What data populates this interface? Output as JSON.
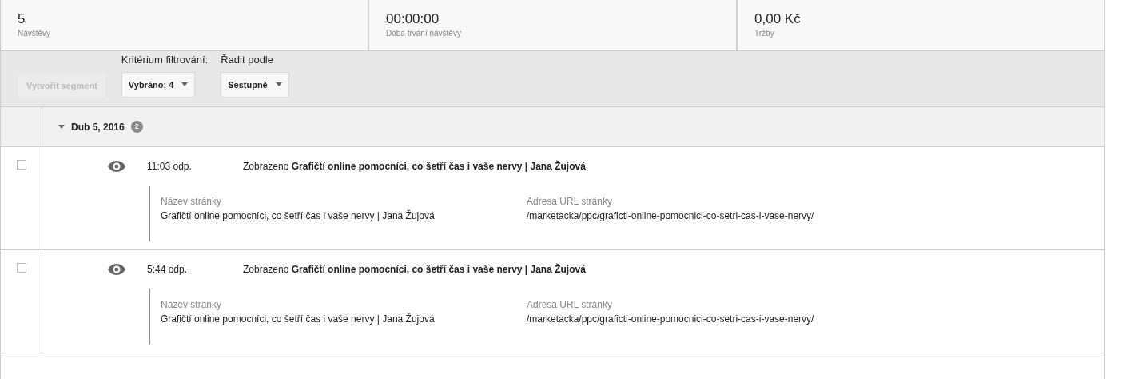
{
  "metrics": [
    {
      "value": "5",
      "label": "Návštěvy"
    },
    {
      "value": "00:00:00",
      "label": "Doba trvání návštěvy"
    },
    {
      "value": "0,00 Kč",
      "label": "Tržby"
    }
  ],
  "toolbar": {
    "create_segment": {
      "label": "Vytvořit segment",
      "disabled": true
    },
    "filters": [
      {
        "label": "Kritérium filtrování:",
        "value": "Vybráno: 4"
      },
      {
        "label": "Řadit podle",
        "value": "Sestupně"
      }
    ]
  },
  "groups": [
    {
      "date": "Dub 5, 2016",
      "count": "2",
      "expanded": true,
      "events": [
        {
          "checked": false,
          "time": "11:03 odp.",
          "description": "Zobrazeno **Grafičtí online pomocníci, co šetří čas i vaše nervy | Jana Žujová**",
          "title_label": "Název stránky",
          "title": "Grafičtí online pomocníci, co šetří čas i vaše nervy | Jana Žujová",
          "url_label": "Adresa URL stránky",
          "url": "/marketacka/ppc/graficti-online-pomocnici-co-setri-cas-i-vase-nervy/"
        },
        {
          "checked": false,
          "time": "5:44 odp.",
          "description": "Zobrazeno **Grafičtí online pomocníci, co šetří čas i vaše nervy | Jana Žujová**",
          "title_label": "Název stránky",
          "title": "Grafičtí online pomocníci, co šetří čas i vaše nervy | Jana Žujová",
          "url_label": "Adresa URL stránky",
          "url": "/marketacka/ppc/graficti-online-pomocnici-co-setri-cas-i-vase-nervy/"
        }
      ]
    }
  ]
}
